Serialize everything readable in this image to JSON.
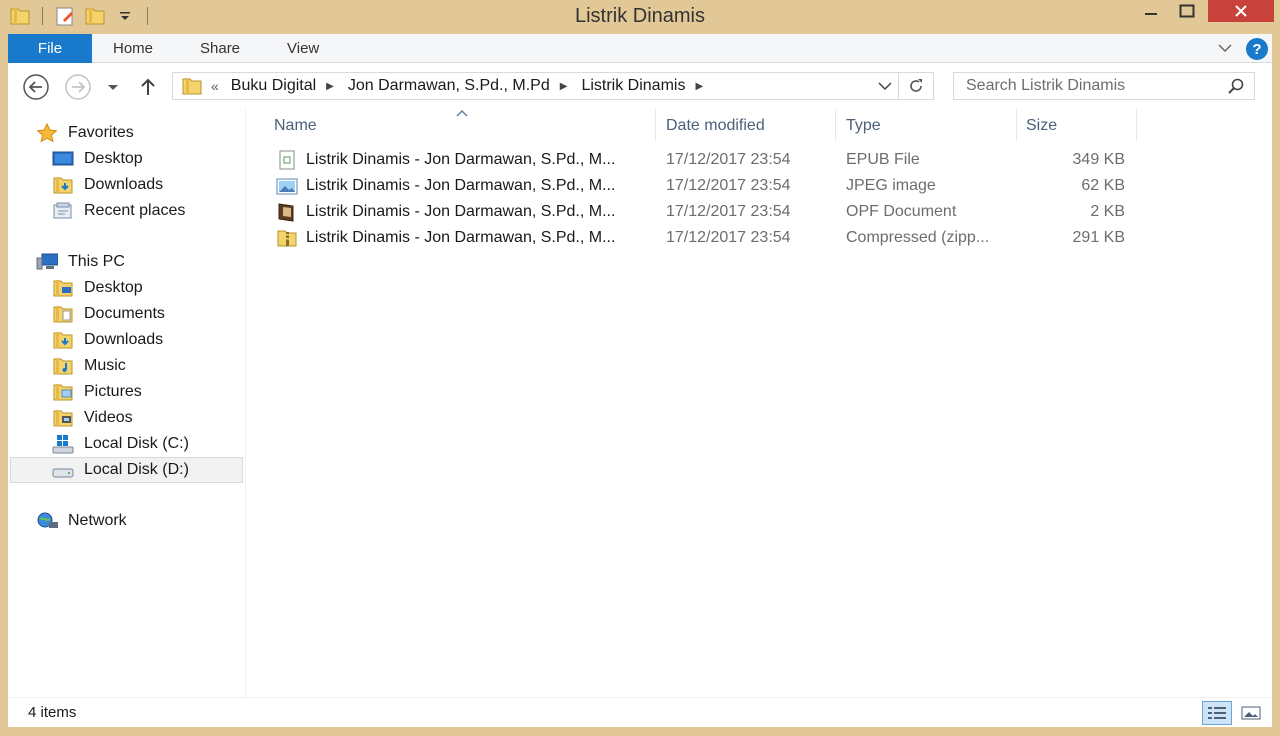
{
  "window": {
    "title": "Listrik Dinamis",
    "minimize_glyph": "—",
    "maximize_glyph": "☐",
    "close_glyph": "✕"
  },
  "ribbon": {
    "tabs": [
      {
        "label": "File"
      },
      {
        "label": "Home"
      },
      {
        "label": "Share"
      },
      {
        "label": "View"
      }
    ],
    "help_glyph": "?"
  },
  "address": {
    "prefix": "«",
    "breadcrumbs": [
      "Buku Digital",
      "Jon Darmawan, S.Pd., M.Pd",
      "Listrik Dinamis"
    ]
  },
  "search": {
    "placeholder": "Search Listrik Dinamis"
  },
  "sidebar": {
    "favorites": {
      "label": "Favorites",
      "items": [
        {
          "label": "Desktop",
          "icon": "desktop-icon"
        },
        {
          "label": "Downloads",
          "icon": "downloads-folder-icon"
        },
        {
          "label": "Recent places",
          "icon": "recent-places-icon"
        }
      ]
    },
    "this_pc": {
      "label": "This PC",
      "items": [
        {
          "label": "Desktop",
          "icon": "desktop-folder-icon"
        },
        {
          "label": "Documents",
          "icon": "documents-folder-icon"
        },
        {
          "label": "Downloads",
          "icon": "downloads-folder-icon"
        },
        {
          "label": "Music",
          "icon": "music-folder-icon"
        },
        {
          "label": "Pictures",
          "icon": "pictures-folder-icon"
        },
        {
          "label": "Videos",
          "icon": "videos-folder-icon"
        },
        {
          "label": "Local Disk (C:)",
          "icon": "windows-drive-icon"
        },
        {
          "label": "Local Disk (D:)",
          "icon": "drive-icon"
        }
      ]
    },
    "network": {
      "label": "Network"
    }
  },
  "columns": {
    "name": "Name",
    "date": "Date modified",
    "type": "Type",
    "size": "Size"
  },
  "files": [
    {
      "name": "Listrik Dinamis - Jon Darmawan, S.Pd., M...",
      "date": "17/12/2017 23:54",
      "type": "EPUB File",
      "size": "349 KB",
      "icon": "epub-file-icon"
    },
    {
      "name": "Listrik Dinamis - Jon Darmawan, S.Pd., M...",
      "date": "17/12/2017 23:54",
      "type": "JPEG image",
      "size": "62 KB",
      "icon": "jpeg-file-icon"
    },
    {
      "name": "Listrik Dinamis - Jon Darmawan, S.Pd., M...",
      "date": "17/12/2017 23:54",
      "type": "OPF Document",
      "size": "2 KB",
      "icon": "opf-file-icon"
    },
    {
      "name": "Listrik Dinamis - Jon Darmawan, S.Pd., M...",
      "date": "17/12/2017 23:54",
      "type": "Compressed (zipp...",
      "size": "291 KB",
      "icon": "zip-file-icon"
    }
  ],
  "status": {
    "items_count": "4 items"
  }
}
